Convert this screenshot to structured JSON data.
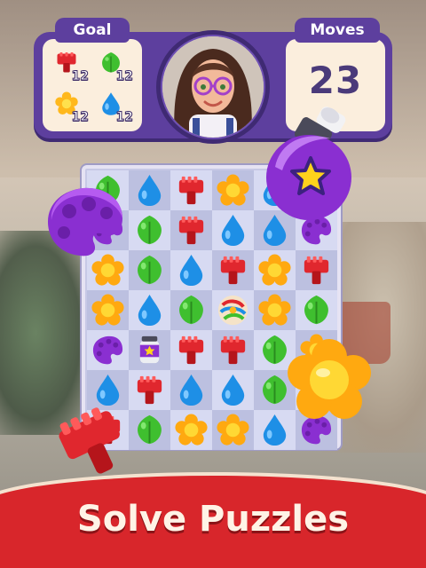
{
  "header": {
    "goal_label": "Goal",
    "moves_label": "Moves",
    "moves_remaining": "23",
    "goals": [
      {
        "piece": "red-brush",
        "count": "12"
      },
      {
        "piece": "green-leaf",
        "count": "12"
      },
      {
        "piece": "yellow-flower",
        "count": "12"
      },
      {
        "piece": "blue-drop",
        "count": "12"
      }
    ]
  },
  "board": {
    "rows": 7,
    "cols": 6,
    "cells": [
      [
        "green-leaf",
        "blue-drop",
        "red-brush",
        "yellow-flower",
        "blue-drop",
        "purple-palette"
      ],
      [
        "purple-palette",
        "green-leaf",
        "red-brush",
        "blue-drop",
        "blue-drop",
        "purple-palette"
      ],
      [
        "yellow-flower",
        "green-leaf",
        "blue-drop",
        "red-brush",
        "yellow-flower",
        "red-brush"
      ],
      [
        "yellow-flower",
        "blue-drop",
        "green-leaf",
        "rainbow-ball",
        "yellow-flower",
        "green-leaf"
      ],
      [
        "purple-palette",
        "paint-can",
        "red-brush",
        "red-brush",
        "green-leaf",
        "yellow-flower"
      ],
      [
        "blue-drop",
        "red-brush",
        "blue-drop",
        "blue-drop",
        "green-leaf",
        "blue-drop"
      ],
      [
        "red-brush",
        "green-leaf",
        "yellow-flower",
        "yellow-flower",
        "blue-drop",
        "purple-palette"
      ]
    ]
  },
  "banner": {
    "title": "Solve Puzzles"
  },
  "colors": {
    "header_purple": "#5d3f9e",
    "panel_cream": "#fbeedd",
    "banner_red": "#d8262b",
    "red": "#e0272e",
    "green": "#3fbf2f",
    "yellow": "#ffb81c",
    "blue": "#1e8fe6",
    "purple": "#8a2fd1"
  },
  "icons": [
    "red-brush-icon",
    "green-leaf-icon",
    "yellow-flower-icon",
    "blue-drop-icon",
    "purple-palette-icon",
    "paint-can-icon",
    "rainbow-ball-icon",
    "character-avatar"
  ]
}
